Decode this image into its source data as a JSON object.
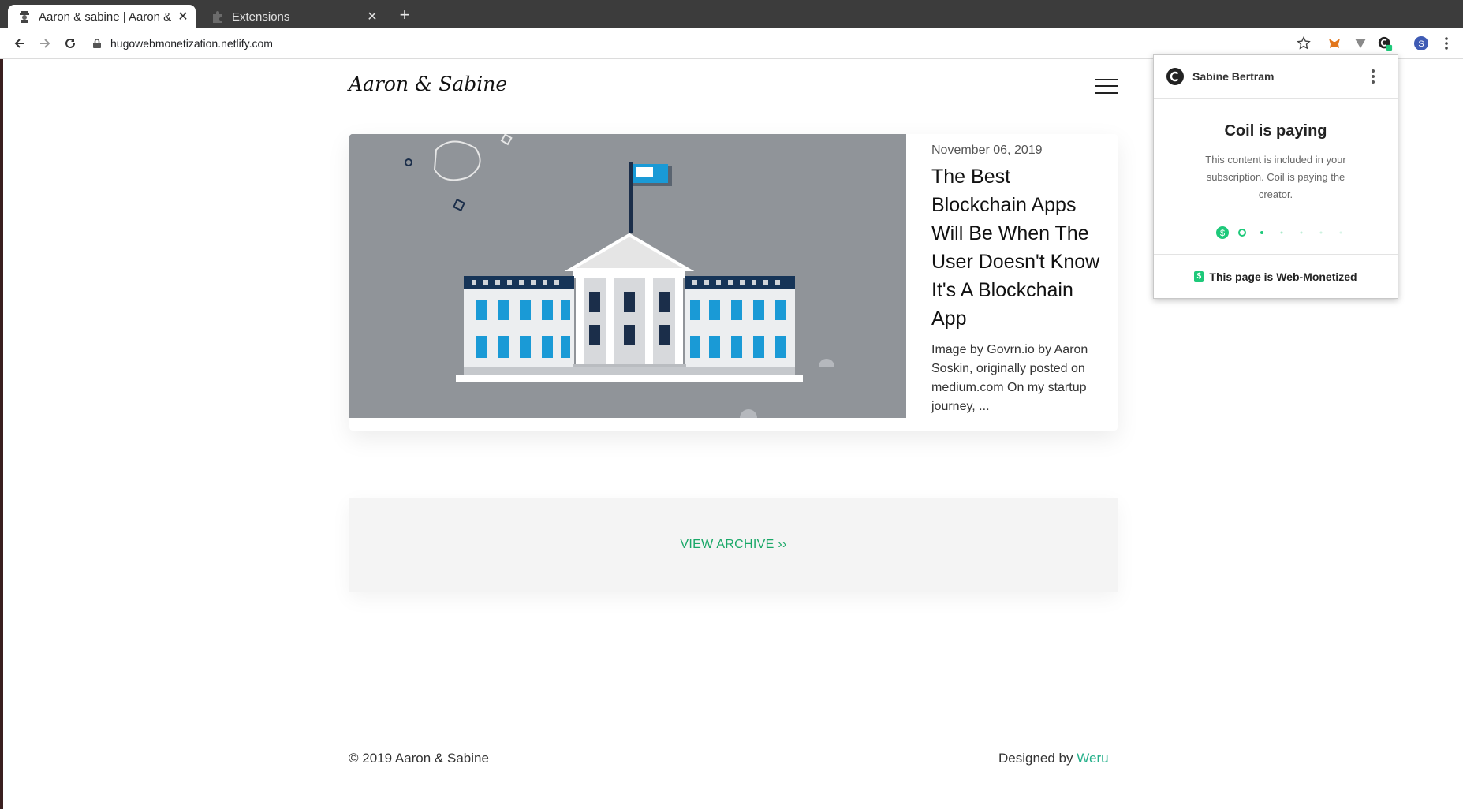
{
  "browser": {
    "tabs": [
      {
        "title": "Aaron & sabine | Aaron & S",
        "close": "✕"
      },
      {
        "title": "Extensions",
        "close": "✕"
      }
    ],
    "new_tab": "+",
    "url": "hugowebmonetization.netlify.com",
    "profile_initial": "S"
  },
  "site": {
    "brand": "Aaron & Sabine",
    "post": {
      "date": "November 06, 2019",
      "title": "The Best Blockchain Apps Will Be When The User Doesn't Know It's A Blockchain App",
      "excerpt": "Image by Govrn.io by Aaron Soskin, originally posted on medium.com On my startup journey, ..."
    },
    "archive": {
      "label": "VIEW ARCHIVE",
      "arrow": "››"
    },
    "footer": {
      "copyright": "© 2019 Aaron & Sabine",
      "designed_by": "Designed by",
      "designer": "Weru"
    }
  },
  "popup": {
    "user": "Sabine Bertram",
    "status": "Coil is paying",
    "description": "This content is included in your subscription. Coil is paying the creator.",
    "footer": "This page is Web-Monetized",
    "badge": "$"
  },
  "colors": {
    "accent": "#1aa868",
    "coil_green": "#1ec97a",
    "image_bg": "#909499"
  }
}
